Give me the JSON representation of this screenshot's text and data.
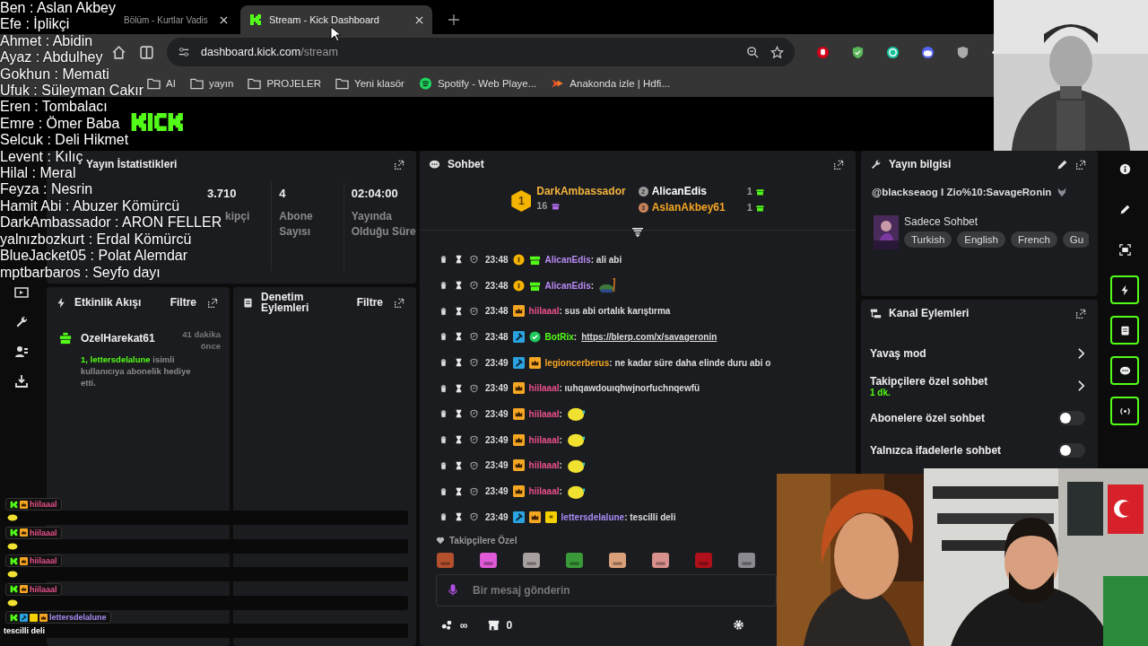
{
  "browser": {
    "tabs": [
      {
        "title": "Bölüm - Kurtlar Vadis",
        "selected": false
      },
      {
        "title": "Stream - Kick Dashboard",
        "selected": true
      }
    ],
    "url_host": "dashboard.kick.com",
    "url_path": "/stream",
    "bookmarks": [
      {
        "label": "AI",
        "kind": "folder"
      },
      {
        "label": "yayın",
        "kind": "folder"
      },
      {
        "label": "PROJELER",
        "kind": "folder"
      },
      {
        "label": "Yeni klasör",
        "kind": "folder"
      },
      {
        "label": "Spotify - Web Playe...",
        "kind": "spotify"
      },
      {
        "label": "Anakonda izle | Hdfi...",
        "kind": "site"
      }
    ]
  },
  "stats": {
    "title": "Yayın İstatistikleri",
    "items": [
      {
        "value": "3.710",
        "label": "kipçi"
      },
      {
        "value": "4",
        "label": "Abone Sayısı"
      },
      {
        "value": "02:04:00",
        "label": "Yayında Olduğu Süre"
      }
    ]
  },
  "activity": {
    "title": "Etkinlik Akışı",
    "filter": "Filtre",
    "events": [
      {
        "user": "OzelHarekat61",
        "time": "41 dakika önce",
        "highlight": "1, lettersdelalune",
        "text": " isimli kullanıcıya abonelik hediye etti."
      }
    ]
  },
  "moderation": {
    "title": "Denetim Eylemleri",
    "filter": "Filtre"
  },
  "chat": {
    "title": "Sohbet",
    "leaders": [
      {
        "rank": "1",
        "name": "DarkAmbassador",
        "count": "16",
        "color": "#f2b43c"
      },
      {
        "rank": "2",
        "name": "AlicanEdis",
        "count": "1",
        "color": "#ffffff"
      },
      {
        "rank": "3",
        "name": "AslanAkbey61",
        "count": "1",
        "color": "#f5a623"
      }
    ],
    "messages": [
      {
        "time": "23:48",
        "badges": [
          {
            "kind": "sub"
          },
          {
            "kind": "gift"
          }
        ],
        "user": "AlicanEdis",
        "color": "#b98bf5",
        "kind": "text",
        "text": ": ali abi"
      },
      {
        "time": "23:48",
        "badges": [
          {
            "kind": "sub"
          },
          {
            "kind": "gift"
          }
        ],
        "user": "AlicanEdis",
        "color": "#b98bf5",
        "kind": "frog",
        "text": ":"
      },
      {
        "time": "23:48",
        "badges": [
          {
            "kind": "crown"
          }
        ],
        "user": "hiilaaal",
        "color": "#e8508a",
        "kind": "text",
        "text": ": sus abi ortalık karıştırma"
      },
      {
        "time": "23:48",
        "badges": [
          {
            "kind": "mod"
          },
          {
            "kind": "verified"
          }
        ],
        "user": "BotRix",
        "color": "#53fc18",
        "kind": "link",
        "text": ":",
        "link": "https://blerp.com/x/savageronin"
      },
      {
        "time": "23:49",
        "badges": [
          {
            "kind": "mod"
          },
          {
            "kind": "crown"
          }
        ],
        "user": "legioncerberus",
        "color": "#f5a623",
        "kind": "text",
        "text": ": ne kadar süre daha elinde duru abi o"
      },
      {
        "time": "23:49",
        "badges": [
          {
            "kind": "crown"
          }
        ],
        "user": "hiilaaal",
        "color": "#e8508a",
        "kind": "text",
        "text": ": ıuhqawdouıqhwjnorfuchnqewfü"
      },
      {
        "time": "23:49",
        "badges": [
          {
            "kind": "crown"
          }
        ],
        "user": "hiilaaal",
        "color": "#e8508a",
        "kind": "blob",
        "text": ":"
      },
      {
        "time": "23:49",
        "badges": [
          {
            "kind": "crown"
          }
        ],
        "user": "hiilaaal",
        "color": "#e8508a",
        "kind": "blob",
        "text": ":"
      },
      {
        "time": "23:49",
        "badges": [
          {
            "kind": "crown"
          }
        ],
        "user": "hiilaaal",
        "color": "#e8508a",
        "kind": "blob",
        "text": ":"
      },
      {
        "time": "23:49",
        "badges": [
          {
            "kind": "crown"
          }
        ],
        "user": "hiilaaal",
        "color": "#e8508a",
        "kind": "blob",
        "text": ":"
      },
      {
        "time": "23:49",
        "badges": [
          {
            "kind": "mod"
          },
          {
            "kind": "crown"
          },
          {
            "kind": "vip"
          }
        ],
        "user": "lettersdelalune",
        "color": "#a98bf5",
        "kind": "text",
        "text": ": tescilli deli"
      }
    ],
    "emote_title": "Takipçilere Özel",
    "emotes": [
      {
        "color": "#b5502e"
      },
      {
        "color": "#e05ad8"
      },
      {
        "color": "#a8a0a0"
      },
      {
        "color": "#3a9a3a"
      },
      {
        "color": "#d9a07a"
      },
      {
        "color": "#d8908c"
      },
      {
        "color": "#b0101a"
      },
      {
        "color": "#8a8a90"
      }
    ],
    "placeholder": "Bir mesaj gönderin",
    "points": "∞",
    "shop_count": "0"
  },
  "stream_info": {
    "title": "Yayın bilgisi",
    "stream_title": "@blackseaog I Zio%10:SavageRonin",
    "category": "Sadece Sohbet",
    "tags": [
      "Turkish",
      "English",
      "French",
      "Gu"
    ]
  },
  "channel_actions": {
    "title": "Kanal Eylemleri",
    "items": [
      {
        "label": "Yavaş mod",
        "kind": "link"
      },
      {
        "label": "Takipçilere özel sohbet",
        "kind": "link",
        "sub": "1 dk."
      },
      {
        "label": "Abonelere özel sohbet",
        "kind": "toggle",
        "on": false
      },
      {
        "label": "Yalnızca ifadelerle sohbet",
        "kind": "toggle",
        "on": false
      }
    ]
  },
  "rail": [
    {
      "kind": "info",
      "on": false
    },
    {
      "kind": "pencil",
      "on": false
    },
    {
      "kind": "capture",
      "on": false
    },
    {
      "kind": "bolt",
      "on": true
    },
    {
      "kind": "note",
      "on": true
    },
    {
      "kind": "chat",
      "on": true
    },
    {
      "kind": "broadcast",
      "on": true
    }
  ],
  "overlay_names": [
    "Ben : Aslan Akbey",
    "Efe : İplikçi",
    "Ahmet : Abidin",
    "Ayaz : Abdulhey",
    "Gokhun : Memati",
    "Ufuk : Süleyman Cakır",
    "Eren : Tombalacı",
    "Emre : Ömer Baba",
    "Selcuk : Deli Hikmet",
    "Levent : Kılıç",
    "Hilal : Meral",
    "Feyza : Nesrin",
    "Hamit Abi : Abuzer Kömürcü",
    "DarkAmbassador : ARON FELLER",
    "yalnızbozkurt : Erdal Kömürcü",
    "BlueJacket05 : Polat Alemdar",
    "mptbarbaros : Seyfo dayı"
  ],
  "overlay_chat": [
    {
      "user": "hiilaaal",
      "color": "#e8508a",
      "badges": [
        {
          "kind": "kick"
        },
        {
          "kind": "crown"
        }
      ],
      "kind": "blob"
    },
    {
      "user": "hiilaaal",
      "color": "#e8508a",
      "badges": [
        {
          "kind": "kick"
        },
        {
          "kind": "crown"
        }
      ],
      "kind": "blob"
    },
    {
      "user": "hiilaaal",
      "color": "#e8508a",
      "badges": [
        {
          "kind": "kick"
        },
        {
          "kind": "crown"
        }
      ],
      "kind": "blob"
    },
    {
      "user": "hiilaaal",
      "color": "#e8508a",
      "badges": [
        {
          "kind": "kick"
        },
        {
          "kind": "crown"
        }
      ],
      "kind": "blob"
    },
    {
      "user": "lettersdelalune",
      "color": "#a98bf5",
      "badges": [
        {
          "kind": "kick"
        },
        {
          "kind": "mod"
        },
        {
          "kind": "vip"
        },
        {
          "kind": "crown"
        }
      ],
      "kind": "text",
      "text": "tescilli deli"
    }
  ]
}
